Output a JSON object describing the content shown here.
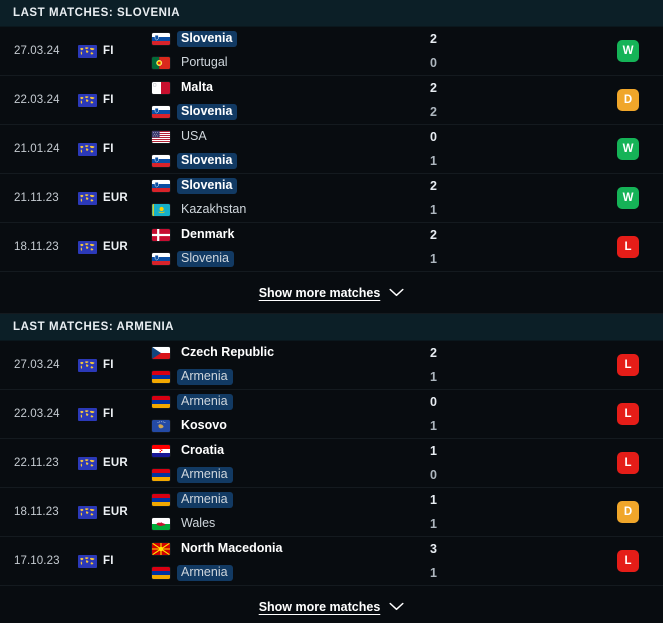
{
  "theme": {
    "page_bg": "#080c10",
    "section_header_bg": "#0c1f27",
    "highlight_pill": "#123a63",
    "win_color": "#15b357",
    "draw_color": "#f0a62a",
    "loss_color": "#e51d18"
  },
  "sections": [
    {
      "title": "LAST MATCHES: SLOVENIA",
      "tracked_team": "Slovenia",
      "show_more_label": "Show more matches",
      "matches": [
        {
          "date": "27.03.24",
          "competition": "FI",
          "competition_icon": "world-map-icon",
          "home": {
            "team": "Slovenia",
            "flag": "si",
            "score": "2",
            "winner": true,
            "highlight": true
          },
          "away": {
            "team": "Portugal",
            "flag": "pt",
            "score": "0",
            "winner": false,
            "highlight": false
          },
          "result": "W"
        },
        {
          "date": "22.03.24",
          "competition": "FI",
          "competition_icon": "world-map-icon",
          "home": {
            "team": "Malta",
            "flag": "mt",
            "score": "2",
            "winner": true,
            "highlight": false
          },
          "away": {
            "team": "Slovenia",
            "flag": "si",
            "score": "2",
            "winner": true,
            "highlight": true
          },
          "result": "D"
        },
        {
          "date": "21.01.24",
          "competition": "FI",
          "competition_icon": "world-map-icon",
          "home": {
            "team": "USA",
            "flag": "us",
            "score": "0",
            "winner": false,
            "highlight": false
          },
          "away": {
            "team": "Slovenia",
            "flag": "si",
            "score": "1",
            "winner": true,
            "highlight": true
          },
          "result": "W"
        },
        {
          "date": "21.11.23",
          "competition": "EUR",
          "competition_icon": "world-map-icon",
          "home": {
            "team": "Slovenia",
            "flag": "si",
            "score": "2",
            "winner": true,
            "highlight": true
          },
          "away": {
            "team": "Kazakhstan",
            "flag": "kz",
            "score": "1",
            "winner": false,
            "highlight": false
          },
          "result": "W"
        },
        {
          "date": "18.11.23",
          "competition": "EUR",
          "competition_icon": "world-map-icon",
          "home": {
            "team": "Denmark",
            "flag": "dk",
            "score": "2",
            "winner": true,
            "highlight": false
          },
          "away": {
            "team": "Slovenia",
            "flag": "si",
            "score": "1",
            "winner": false,
            "highlight": true
          },
          "result": "L"
        }
      ]
    },
    {
      "title": "LAST MATCHES: ARMENIA",
      "tracked_team": "Armenia",
      "show_more_label": "Show more matches",
      "matches": [
        {
          "date": "27.03.24",
          "competition": "FI",
          "competition_icon": "world-map-icon",
          "home": {
            "team": "Czech Republic",
            "flag": "cz",
            "score": "2",
            "winner": true,
            "highlight": false
          },
          "away": {
            "team": "Armenia",
            "flag": "am",
            "score": "1",
            "winner": false,
            "highlight": true
          },
          "result": "L"
        },
        {
          "date": "22.03.24",
          "competition": "FI",
          "competition_icon": "world-map-icon",
          "home": {
            "team": "Armenia",
            "flag": "am",
            "score": "0",
            "winner": false,
            "highlight": true
          },
          "away": {
            "team": "Kosovo",
            "flag": "xk",
            "score": "1",
            "winner": true,
            "highlight": false
          },
          "result": "L"
        },
        {
          "date": "22.11.23",
          "competition": "EUR",
          "competition_icon": "world-map-icon",
          "home": {
            "team": "Croatia",
            "flag": "hr",
            "score": "1",
            "winner": true,
            "highlight": false
          },
          "away": {
            "team": "Armenia",
            "flag": "am",
            "score": "0",
            "winner": false,
            "highlight": true
          },
          "result": "L"
        },
        {
          "date": "18.11.23",
          "competition": "EUR",
          "competition_icon": "world-map-icon",
          "home": {
            "team": "Armenia",
            "flag": "am",
            "score": "1",
            "winner": false,
            "highlight": true
          },
          "away": {
            "team": "Wales",
            "flag": "wl",
            "score": "1",
            "winner": false,
            "highlight": false
          },
          "result": "D"
        },
        {
          "date": "17.10.23",
          "competition": "FI",
          "competition_icon": "world-map-icon",
          "home": {
            "team": "North Macedonia",
            "flag": "mk",
            "score": "3",
            "winner": true,
            "highlight": false
          },
          "away": {
            "team": "Armenia",
            "flag": "am",
            "score": "1",
            "winner": false,
            "highlight": true
          },
          "result": "L"
        }
      ]
    }
  ]
}
